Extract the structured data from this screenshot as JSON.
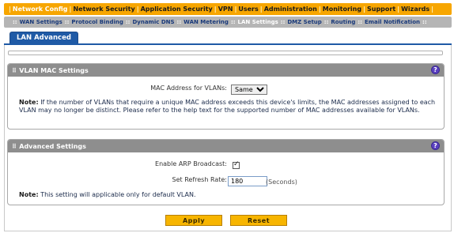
{
  "top_nav": {
    "items": [
      {
        "label": "Network Config",
        "active": true
      },
      {
        "label": "Network Security",
        "active": false
      },
      {
        "label": "Application Security",
        "active": false
      },
      {
        "label": "VPN",
        "active": false
      },
      {
        "label": "Users",
        "active": false
      },
      {
        "label": "Administration",
        "active": false
      },
      {
        "label": "Monitoring",
        "active": false
      },
      {
        "label": "Support",
        "active": false
      },
      {
        "label": "Wizards",
        "active": false
      }
    ]
  },
  "sub_nav": {
    "items": [
      {
        "label": "WAN Settings",
        "active": false
      },
      {
        "label": "Protocol Binding",
        "active": false
      },
      {
        "label": "Dynamic DNS",
        "active": false
      },
      {
        "label": "WAN Metering",
        "active": false
      },
      {
        "label": "LAN Settings",
        "active": true
      },
      {
        "label": "DMZ Setup",
        "active": false
      },
      {
        "label": "Routing",
        "active": false
      },
      {
        "label": "Email Notification",
        "active": false
      }
    ]
  },
  "tab": {
    "label": "LAN Advanced"
  },
  "vlan_mac": {
    "title": "VLAN MAC Settings",
    "mac_label": "MAC Address for VLANs:",
    "mac_value": "Same",
    "note_prefix": "Note:",
    "note_text": "If the number of VLANs that require a unique MAC address exceeds this device's limits, the MAC addresses assigned to each VLAN may no longer be distinct. Please refer to the help text for the supported number of MAC addresses available for VLANs."
  },
  "advanced": {
    "title": "Advanced Settings",
    "arp_label": "Enable ARP Broadcast:",
    "arp_checked": true,
    "refresh_label": "Set Refresh Rate:",
    "refresh_value": "180",
    "refresh_unit": "(Seconds)",
    "note_prefix": "Note:",
    "note_text": "This setting will applicable only for default VLAN."
  },
  "buttons": {
    "apply": "Apply",
    "reset": "Reset"
  },
  "help_glyph": "?",
  "grip_glyph": "⠿"
}
